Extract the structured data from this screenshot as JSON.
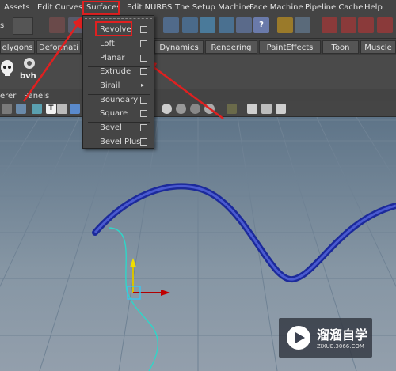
{
  "menubar": {
    "items": [
      "Assets",
      "Edit Curves",
      "Surfaces",
      "Edit NURBS",
      "The Setup Machine",
      "Face Machine",
      "Pipeline Cache",
      "Help"
    ],
    "active": "Surfaces"
  },
  "shelf_tabs": [
    "olygons",
    "Deformati",
    "Dynamics",
    "Rendering",
    "PaintEffects",
    "Toon",
    "Muscle"
  ],
  "shelf": {
    "bvh_label": "bvh"
  },
  "panel_menu": {
    "items": [
      "erer",
      "Panels"
    ]
  },
  "surfaces_menu": {
    "items": [
      {
        "label": "Revolve",
        "option": true
      },
      {
        "label": "Loft",
        "option": true
      },
      {
        "label": "Planar",
        "option": true
      },
      {
        "label": "Extrude",
        "option": true
      },
      {
        "label": "Birail",
        "submenu": true
      },
      {
        "label": "Boundary",
        "option": true
      },
      {
        "label": "Square",
        "option": true
      },
      {
        "label": "Bevel",
        "option": true
      },
      {
        "label": "Bevel Plus",
        "option": true
      }
    ]
  },
  "watermark": {
    "title": "溜溜自学",
    "url": "ZIXUE.3066.COM"
  },
  "colors": {
    "highlight_red": "#e02020",
    "nurbs_curve": "#1c2a9a",
    "profile_curve": "#2fd6c8",
    "viewport_top": "#5e7488",
    "viewport_bottom": "#939fac"
  }
}
